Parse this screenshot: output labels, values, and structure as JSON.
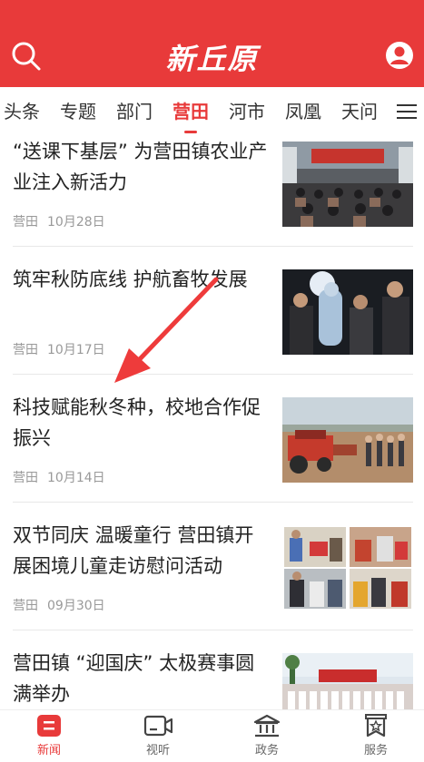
{
  "header": {
    "logo_text": "新丘原",
    "search_icon": "search-icon",
    "user_icon": "user-icon"
  },
  "tabs": [
    {
      "label": "头条",
      "active": false
    },
    {
      "label": "专题",
      "active": false
    },
    {
      "label": "部门",
      "active": false
    },
    {
      "label": "营田",
      "active": true
    },
    {
      "label": "河市",
      "active": false
    },
    {
      "label": "凤凰",
      "active": false
    },
    {
      "label": "天问",
      "active": false
    }
  ],
  "menu_icon": "menu-icon",
  "articles": [
    {
      "title": "“送课下基层” 为营田镇农业产业注入新活力",
      "source": "营田",
      "date": "10月28日",
      "thumb": "classroom-photo"
    },
    {
      "title": "筑牢秋防底线 护航畜牧发展",
      "source": "营田",
      "date": "10月17日",
      "thumb": "night-inspection-photo"
    },
    {
      "title": "科技赋能秋冬种，校地合作促振兴",
      "source": "营田",
      "date": "10月14日",
      "thumb": "farm-machine-photo"
    },
    {
      "title": "双节同庆 温暖童行 营田镇开展困境儿童走访慰问活动",
      "source": "营田",
      "date": "09月30日",
      "thumb": "photo-collage"
    },
    {
      "title": "营田镇 “迎国庆” 太极赛事圆满举办",
      "source": "",
      "date": "",
      "thumb": "taichi-event-photo"
    }
  ],
  "bottom_nav": [
    {
      "label": "新闻",
      "icon": "news-icon",
      "active": true
    },
    {
      "label": "视听",
      "icon": "video-icon",
      "active": false
    },
    {
      "label": "政务",
      "icon": "government-icon",
      "active": false
    },
    {
      "label": "服务",
      "icon": "service-icon",
      "active": false
    }
  ],
  "colors": {
    "brand_red": "#e83a3a",
    "text_dark": "#222222",
    "meta_gray": "#999999"
  }
}
